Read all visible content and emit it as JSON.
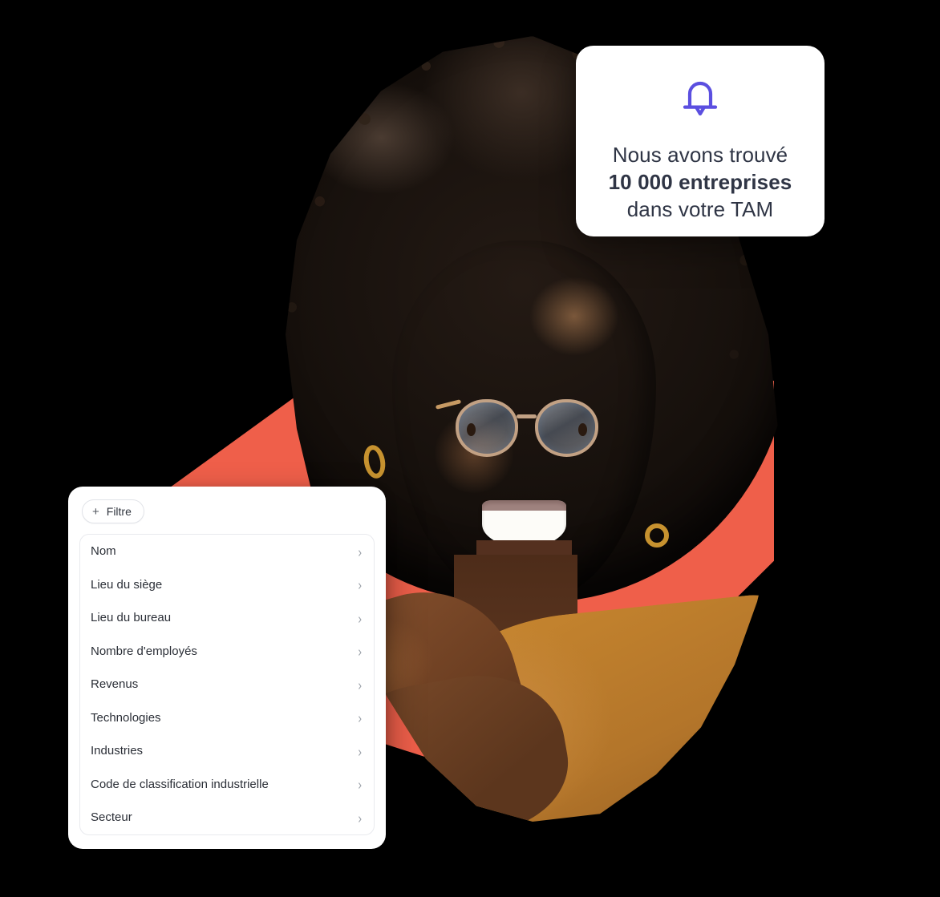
{
  "background_color": "#000000",
  "accent_colors": {
    "coral": "#ef5f4a",
    "bell_purple": "#5b4fe0",
    "text_dark": "#2f3545",
    "sweater_orange": "#c8872f"
  },
  "notification_card": {
    "icon": "bell-icon",
    "line1": "Nous avons trouvé",
    "line2_bold": "10 000 entreprises",
    "line3": "dans votre TAM"
  },
  "filter_panel": {
    "filter_button": {
      "icon": "plus-icon",
      "label": "Filtre"
    },
    "chevron_icon": "chevron-right-icon",
    "items": [
      {
        "label": "Nom"
      },
      {
        "label": "Lieu du siège"
      },
      {
        "label": "Lieu du bureau"
      },
      {
        "label": "Nombre d'employés"
      },
      {
        "label": "Revenus"
      },
      {
        "label": "Technologies"
      },
      {
        "label": "Industries"
      },
      {
        "label": "Code de classification industrielle"
      },
      {
        "label": "Secteur"
      }
    ]
  },
  "hero_image": {
    "alt": "smiling-woman-portrait",
    "decor_shape": "coral-polygon"
  }
}
